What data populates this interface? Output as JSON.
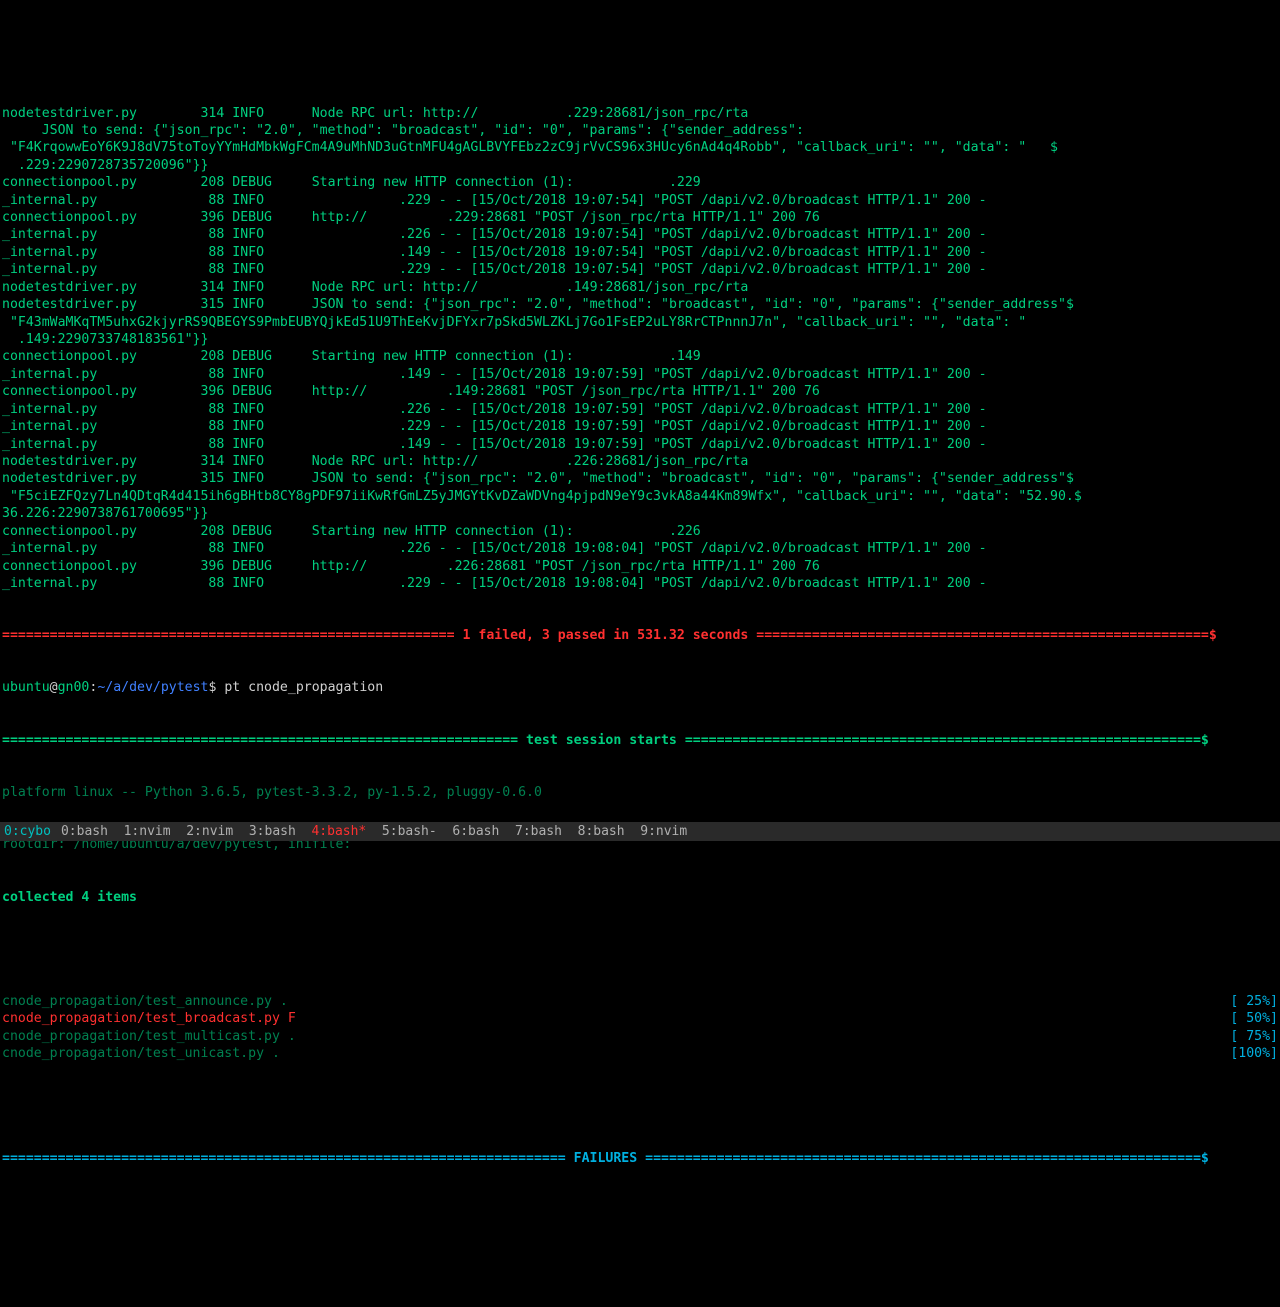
{
  "log": [
    {
      "f": "nodetestdriver.py",
      "ln": "314",
      "lvl": "INFO",
      "msg": "Node RPC url: http://           .229:28681/json_rpc/rta"
    },
    {
      "f": "",
      "ln": "",
      "lvl": "",
      "msg": "     JSON to send: {\"json_rpc\": \"2.0\", \"method\": \"broadcast\", \"id\": \"0\", \"params\": {\"sender_address\":"
    },
    {
      "f": "",
      "ln": "",
      "lvl": "",
      "msg": " \"F4KrqowwEoY6K9J8dV75toToyYYmHdMbkWgFCm4A9uMhND3uGtnMFU4gAGLBVYFEbz2zC9jrVvCS96x3HUcy6nAd4q4Robb\", \"callback_uri\": \"\", \"data\": \"   $"
    },
    {
      "f": "",
      "ln": "",
      "lvl": "",
      "msg": "  .229:2290728735720096\"}}"
    },
    {
      "f": "connectionpool.py",
      "ln": "208",
      "lvl": "DEBUG",
      "msg": "Starting new HTTP connection (1):            .229"
    },
    {
      "f": "_internal.py",
      "ln": "88",
      "lvl": "INFO",
      "msg": "           .229 - - [15/Oct/2018 19:07:54] \"POST /dapi/v2.0/broadcast HTTP/1.1\" 200 -"
    },
    {
      "f": "connectionpool.py",
      "ln": "396",
      "lvl": "DEBUG",
      "msg": "http://          .229:28681 \"POST /json_rpc/rta HTTP/1.1\" 200 76"
    },
    {
      "f": "_internal.py",
      "ln": "88",
      "lvl": "INFO",
      "msg": "           .226 - - [15/Oct/2018 19:07:54] \"POST /dapi/v2.0/broadcast HTTP/1.1\" 200 -"
    },
    {
      "f": "_internal.py",
      "ln": "88",
      "lvl": "INFO",
      "msg": "           .149 - - [15/Oct/2018 19:07:54] \"POST /dapi/v2.0/broadcast HTTP/1.1\" 200 -"
    },
    {
      "f": "_internal.py",
      "ln": "88",
      "lvl": "INFO",
      "msg": "           .229 - - [15/Oct/2018 19:07:54] \"POST /dapi/v2.0/broadcast HTTP/1.1\" 200 -"
    },
    {
      "f": "nodetestdriver.py",
      "ln": "314",
      "lvl": "INFO",
      "msg": "Node RPC url: http://           .149:28681/json_rpc/rta"
    },
    {
      "f": "nodetestdriver.py",
      "ln": "315",
      "lvl": "INFO",
      "msg": "JSON to send: {\"json_rpc\": \"2.0\", \"method\": \"broadcast\", \"id\": \"0\", \"params\": {\"sender_address\"$"
    },
    {
      "f": "",
      "ln": "",
      "lvl": "",
      "msg": " \"F43mWaMKqTM5uhxG2kjyrRS9QBEGYS9PmbEUBYQjkEd51U9ThEeKvjDFYxr7pSkd5WLZKLj7Go1FsEP2uLY8RrCTPnnnJ7n\", \"callback_uri\": \"\", \"data\": \""
    },
    {
      "f": "",
      "ln": "",
      "lvl": "",
      "msg": "  .149:2290733748183561\"}}"
    },
    {
      "f": "connectionpool.py",
      "ln": "208",
      "lvl": "DEBUG",
      "msg": "Starting new HTTP connection (1):            .149"
    },
    {
      "f": "_internal.py",
      "ln": "88",
      "lvl": "INFO",
      "msg": "           .149 - - [15/Oct/2018 19:07:59] \"POST /dapi/v2.0/broadcast HTTP/1.1\" 200 -"
    },
    {
      "f": "connectionpool.py",
      "ln": "396",
      "lvl": "DEBUG",
      "msg": "http://          .149:28681 \"POST /json_rpc/rta HTTP/1.1\" 200 76"
    },
    {
      "f": "_internal.py",
      "ln": "88",
      "lvl": "INFO",
      "msg": "           .226 - - [15/Oct/2018 19:07:59] \"POST /dapi/v2.0/broadcast HTTP/1.1\" 200 -"
    },
    {
      "f": "_internal.py",
      "ln": "88",
      "lvl": "INFO",
      "msg": "           .229 - - [15/Oct/2018 19:07:59] \"POST /dapi/v2.0/broadcast HTTP/1.1\" 200 -"
    },
    {
      "f": "_internal.py",
      "ln": "88",
      "lvl": "INFO",
      "msg": "           .149 - - [15/Oct/2018 19:07:59] \"POST /dapi/v2.0/broadcast HTTP/1.1\" 200 -"
    },
    {
      "f": "nodetestdriver.py",
      "ln": "314",
      "lvl": "INFO",
      "msg": "Node RPC url: http://           .226:28681/json_rpc/rta"
    },
    {
      "f": "nodetestdriver.py",
      "ln": "315",
      "lvl": "INFO",
      "msg": "JSON to send: {\"json_rpc\": \"2.0\", \"method\": \"broadcast\", \"id\": \"0\", \"params\": {\"sender_address\"$"
    },
    {
      "f": "",
      "ln": "",
      "lvl": "",
      "msg": " \"F5ciEZFQzy7Ln4QDtqR4d415ih6gBHtb8CY8gPDF97iiKwRfGmLZ5yJMGYtKvDZaWDVng4pjpdN9eY9c3vkA8a44Km89Wfx\", \"callback_uri\": \"\", \"data\": \"52.90.$"
    },
    {
      "f": "",
      "ln": "",
      "lvl": "",
      "msg": "36.226:2290738761700695\"}}"
    },
    {
      "f": "connectionpool.py",
      "ln": "208",
      "lvl": "DEBUG",
      "msg": "Starting new HTTP connection (1):            .226"
    },
    {
      "f": "_internal.py",
      "ln": "88",
      "lvl": "INFO",
      "msg": "           .226 - - [15/Oct/2018 19:08:04] \"POST /dapi/v2.0/broadcast HTTP/1.1\" 200 -"
    },
    {
      "f": "connectionpool.py",
      "ln": "396",
      "lvl": "DEBUG",
      "msg": "http://          .226:28681 \"POST /json_rpc/rta HTTP/1.1\" 200 76"
    },
    {
      "f": "_internal.py",
      "ln": "88",
      "lvl": "INFO",
      "msg": "           .229 - - [15/Oct/2018 19:08:04] \"POST /dapi/v2.0/broadcast HTTP/1.1\" 200 -"
    }
  ],
  "summary1": {
    "pre": "========================================================= ",
    "txt": "1 failed, 3 passed in 531.32 seconds",
    "post": " =========================================================$"
  },
  "prompt": {
    "user": "ubuntu",
    "at": "@",
    "host": "gn00",
    "colon": ":",
    "path": "~/a/dev/pytest",
    "dollar": "$ ",
    "cmd": "pt cnode_propagation"
  },
  "sessionstart": {
    "pre": "================================================================= ",
    "txt": "test session starts",
    "post": " =================================================================$"
  },
  "platform": "platform linux -- Python 3.6.5, pytest-3.3.2, py-1.5.2, pluggy-0.6.0",
  "rootdir": "rootdir: /home/ubuntu/a/dev/pytest, inifile:",
  "collected": "collected 4 items",
  "tests": [
    {
      "name": "cnode_propagation/test_announce.py .",
      "pct": "[ 25%]"
    },
    {
      "name": "cnode_propagation/test_broadcast.py F",
      "pct": "[ 50%]"
    },
    {
      "name": "cnode_propagation/test_multicast.py .",
      "pct": "[ 75%]"
    },
    {
      "name": "cnode_propagation/test_unicast.py .",
      "pct": "[100%]"
    }
  ],
  "failures": {
    "pre": "======================================================================= ",
    "txt": "FAILURES",
    "post": " ======================================================================$"
  },
  "statusbar": {
    "session": "0:cybo",
    "tabs": [
      "0:bash",
      "1:nvim",
      "2:nvim",
      "3:bash",
      "4:bash*",
      "5:bash-",
      "6:bash",
      "7:bash",
      "8:bash",
      "9:nvim"
    ],
    "active": 4
  }
}
